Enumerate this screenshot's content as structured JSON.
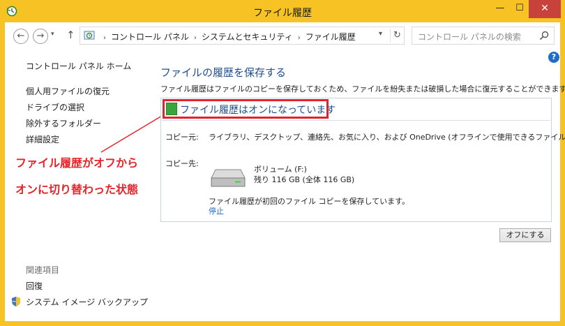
{
  "window": {
    "title": "ファイル履歴",
    "minimize": "—",
    "maximize": "☐",
    "close": "✕"
  },
  "nav": {
    "back": "←",
    "forward": "→",
    "history": "▾",
    "up": "↑"
  },
  "address": {
    "crumbs": [
      "コントロール パネル",
      "システムとセキュリティ",
      "ファイル履歴"
    ],
    "separator": "›",
    "dropdown": "▾",
    "refresh": "↻"
  },
  "search": {
    "placeholder": "コントロール パネルの検索"
  },
  "help": "?",
  "sidebar": {
    "home": "コントロール パネル ホーム",
    "links": [
      "個人用ファイルの復元",
      "ドライブの選択",
      "除外するフォルダー",
      "詳細設定"
    ],
    "related_heading": "関連項目",
    "related": [
      "回復",
      "システム イメージ バックアップ"
    ]
  },
  "annotation": {
    "line1": "ファイル履歴がオフから",
    "line2": "オンに切り替わった状態"
  },
  "main": {
    "heading": "ファイルの履歴を保存する",
    "description": "ファイル履歴はファイルのコピーを保存しておくため、ファイルを紛失または破損した場合に復元することができます。",
    "status": "ファイル履歴はオンになっています",
    "copy_source_label": "コピー元:",
    "copy_source_value": "ライブラリ、デスクトップ、連絡先、お気に入り、および OneDrive (オフラインで使用できるファイルのみ)",
    "copy_dest_label": "コピー先:",
    "volume_name": "ボリューム (F:)",
    "volume_free": "残り 116 GB (全体 116 GB)",
    "copy_status": "ファイル履歴が初回のファイル コピーを保存しています。",
    "stop_link": "停止",
    "off_button": "オフにする"
  },
  "colors": {
    "title_bar": "#f7c324",
    "close_button": "#c7423a",
    "heading_blue": "#1e4e8c",
    "annotation_red": "#e8242a",
    "status_green": "#3aa53a"
  }
}
